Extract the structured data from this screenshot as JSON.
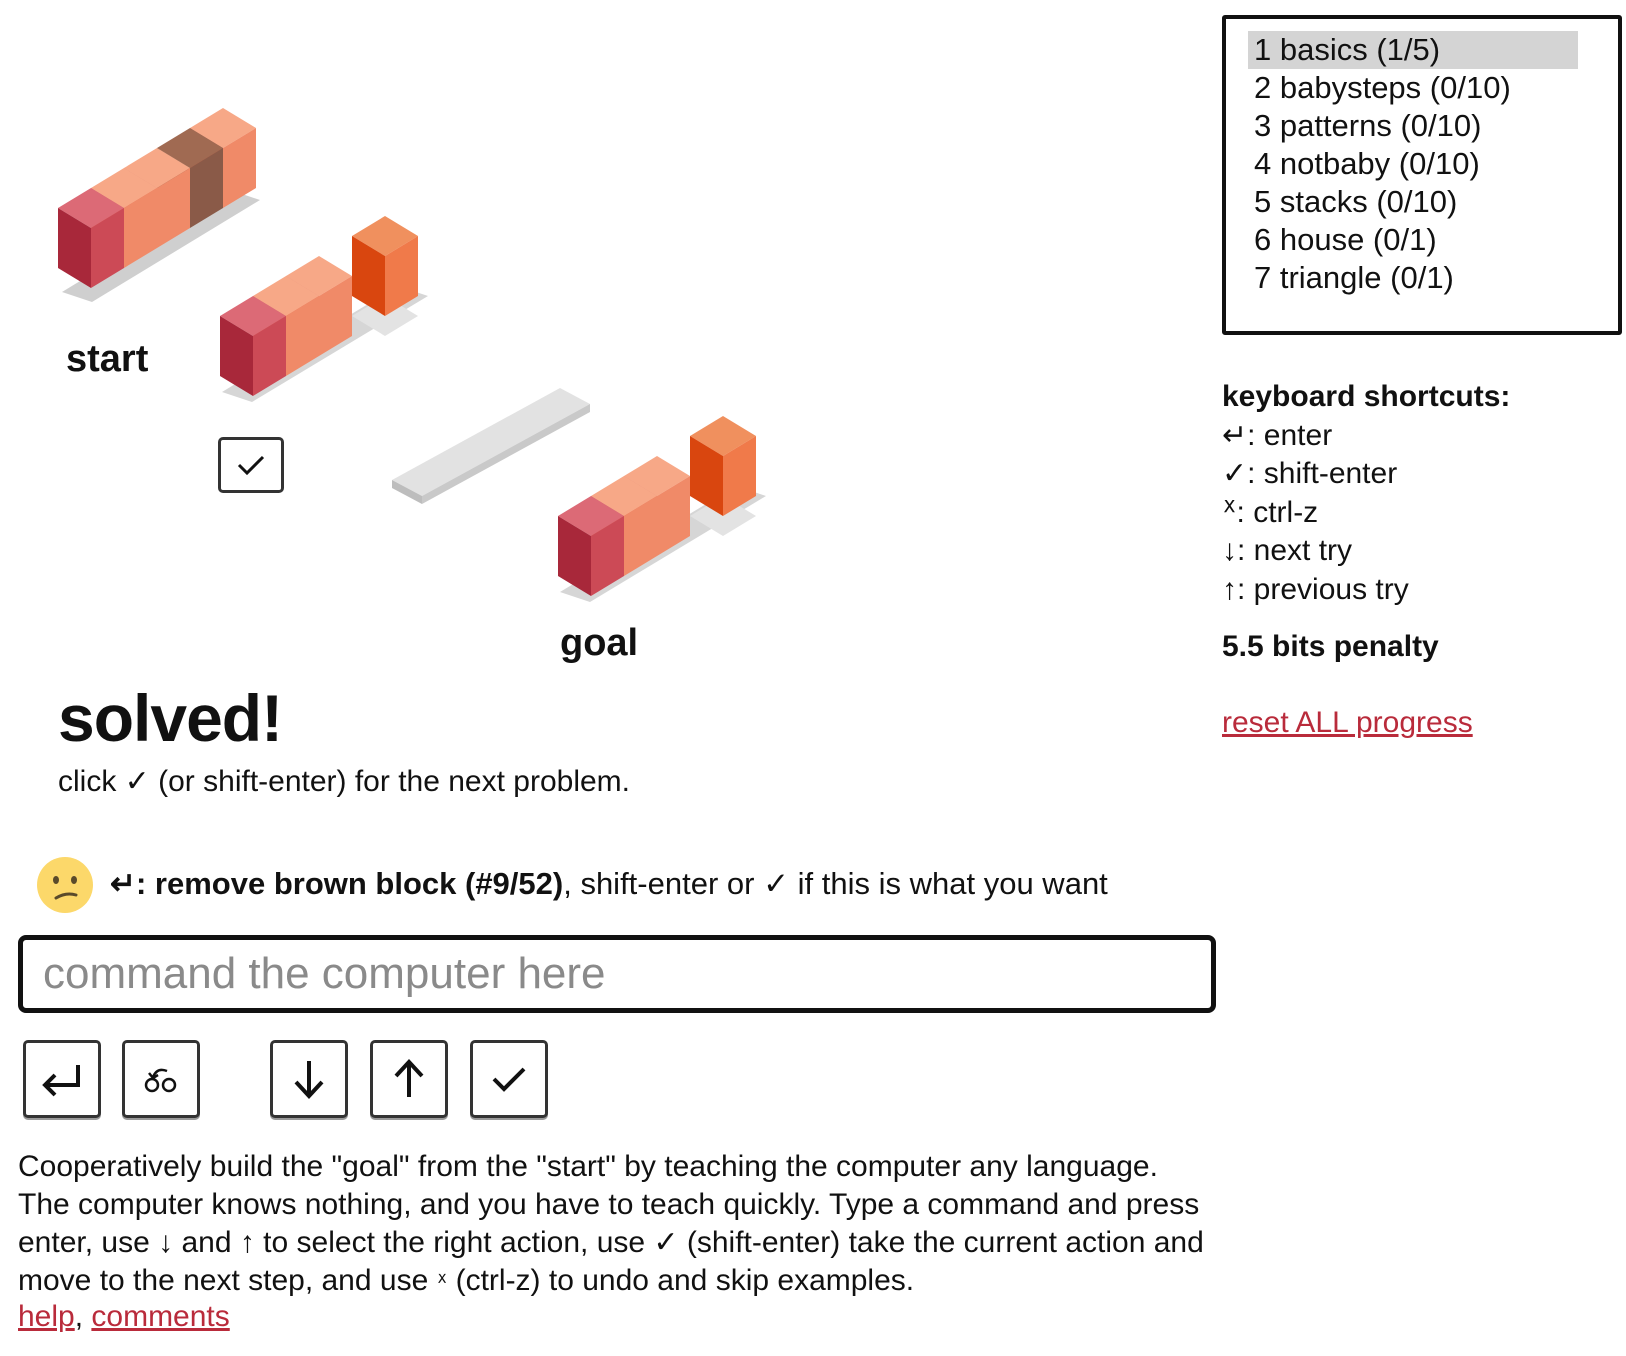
{
  "scene": {
    "start_label": "start",
    "goal_label": "goal"
  },
  "status": {
    "title": "solved!",
    "subtitle": "click ✓ (or shift-enter) for the next problem."
  },
  "feedback": {
    "enter_symbol": "↵",
    "action": ": remove brown block (#9/52)",
    "rest": ", shift-enter or ✓ if this is what you want"
  },
  "command": {
    "placeholder": "command the computer here",
    "value": ""
  },
  "buttons": {
    "enter": "enter-icon",
    "undo": "undo-icon",
    "down": "down-arrow-icon",
    "up": "up-arrow-icon",
    "accept": "check-icon"
  },
  "description": {
    "p1": "Cooperatively build the \"goal\" from the \"start\" by teaching the computer any language. The computer knows nothing, and you have to teach quickly. Type a command and press enter, use ",
    "down": "↓",
    "p2": " and ",
    "up": "↑",
    "p3": " to select the right action, use ✓ (shift-enter) take the current action and move to the next step, and use ",
    "undo": "ᕽ",
    "p4": " (ctrl-z) to undo and skip examples."
  },
  "links": {
    "help": "help",
    "separator": ", ",
    "comments": "comments"
  },
  "levels": [
    "1 basics (1/5)",
    "2 babysteps (0/10)",
    "3 patterns (0/10)",
    "4 notbaby (0/10)",
    "5 stacks (0/10)",
    "6 house (0/1)",
    "7 triangle (0/1)"
  ],
  "selected_level": 0,
  "shortcuts": {
    "header": "keyboard shortcuts:",
    "items": [
      "↵: enter",
      "✓: shift-enter",
      "ᕽ: ctrl-z",
      "↓: next try",
      "↑: previous try"
    ]
  },
  "penalty": "5.5 bits penalty",
  "reset": "reset ALL progress",
  "colors": {
    "block_salmon": "#f08a68",
    "block_red": "#cc4a56",
    "block_brown": "#8a5a48",
    "block_orange": "#e8531f",
    "platform": "#d8d8d8",
    "link": "#b92b3b",
    "selected_bg": "#d4d4d4"
  }
}
